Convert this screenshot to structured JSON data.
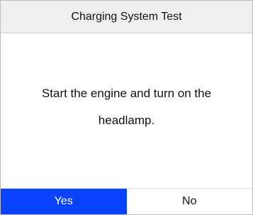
{
  "header": {
    "title": "Charging System Test"
  },
  "dialog": {
    "message": "Start the engine and turn on the headlamp."
  },
  "buttons": {
    "yes": "Yes",
    "no": "No"
  },
  "colors": {
    "header_bg": "#efefef",
    "selected_button_bg": "#0a43ff",
    "selected_button_text": "#ffffff",
    "unselected_button_bg": "#ffffff",
    "text": "#111111"
  }
}
